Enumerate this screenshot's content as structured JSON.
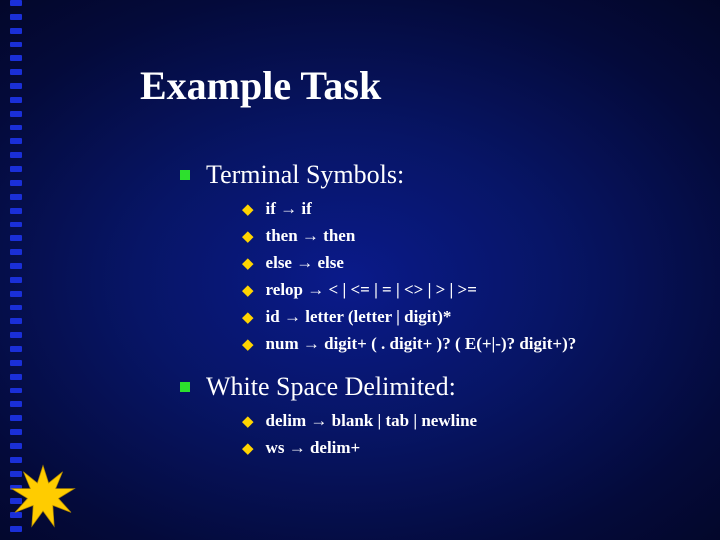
{
  "slide": {
    "title": "Example Task",
    "sections": [
      {
        "heading": "Terminal Symbols:",
        "items": [
          "if → if",
          "then → then",
          "else → else",
          "relop → < | <= | = | <> | > | >=",
          "id → letter (letter | digit)*",
          "num → digit+ ( . digit+ )? ( E(+|-)? digit+)?"
        ]
      },
      {
        "heading": "White Space Delimited:",
        "items": [
          "delim → blank | tab | newline",
          "ws → delim+"
        ]
      }
    ]
  }
}
